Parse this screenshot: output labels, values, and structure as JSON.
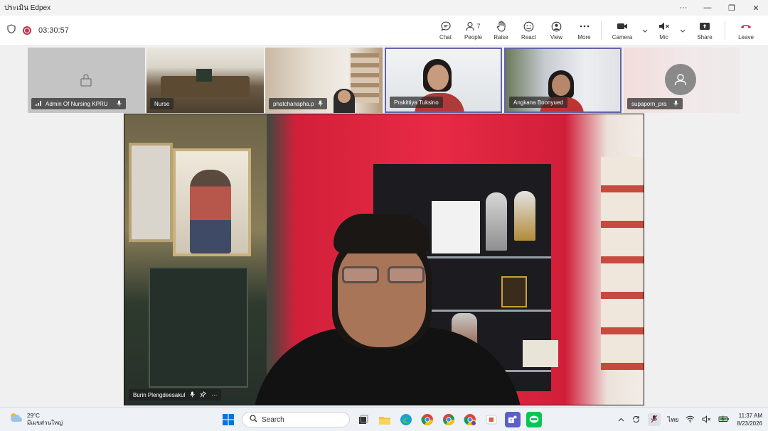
{
  "window": {
    "title": "ประเมิน Edpex",
    "controls": {
      "more": "···",
      "minimize": "—",
      "restore": "❐",
      "close": "✕"
    }
  },
  "toolbar": {
    "timer": "03:30:57",
    "people_count": "7",
    "buttons": {
      "chat": "Chat",
      "people": "People",
      "raise": "Raise",
      "react": "React",
      "view": "View",
      "more": "More",
      "camera": "Camera",
      "mic": "Mic",
      "share": "Share",
      "leave": "Leave"
    },
    "colors": {
      "leave": "#c4314b",
      "accent": "#6264a7"
    }
  },
  "participants": [
    {
      "name": "Admin Of Nursing KPRU",
      "muted": true
    },
    {
      "name": "Nurse",
      "muted": false
    },
    {
      "name": "phatchanapha.p",
      "muted": true
    },
    {
      "name": "Prakittiya Tuksino",
      "muted": false
    },
    {
      "name": "Angkana Boonyued",
      "muted": false
    },
    {
      "name": "supaporn_pra",
      "muted": true
    }
  ],
  "main_speaker": {
    "name": "Burin Plengdeesakul",
    "more": "···"
  },
  "taskbar": {
    "weather": {
      "temp": "29°C",
      "desc": "มีเมฆส่วนใหญ่"
    },
    "search_placeholder": "Search",
    "lang": "ไทย",
    "time": "11:37 AM",
    "date": "8/23/2026"
  }
}
